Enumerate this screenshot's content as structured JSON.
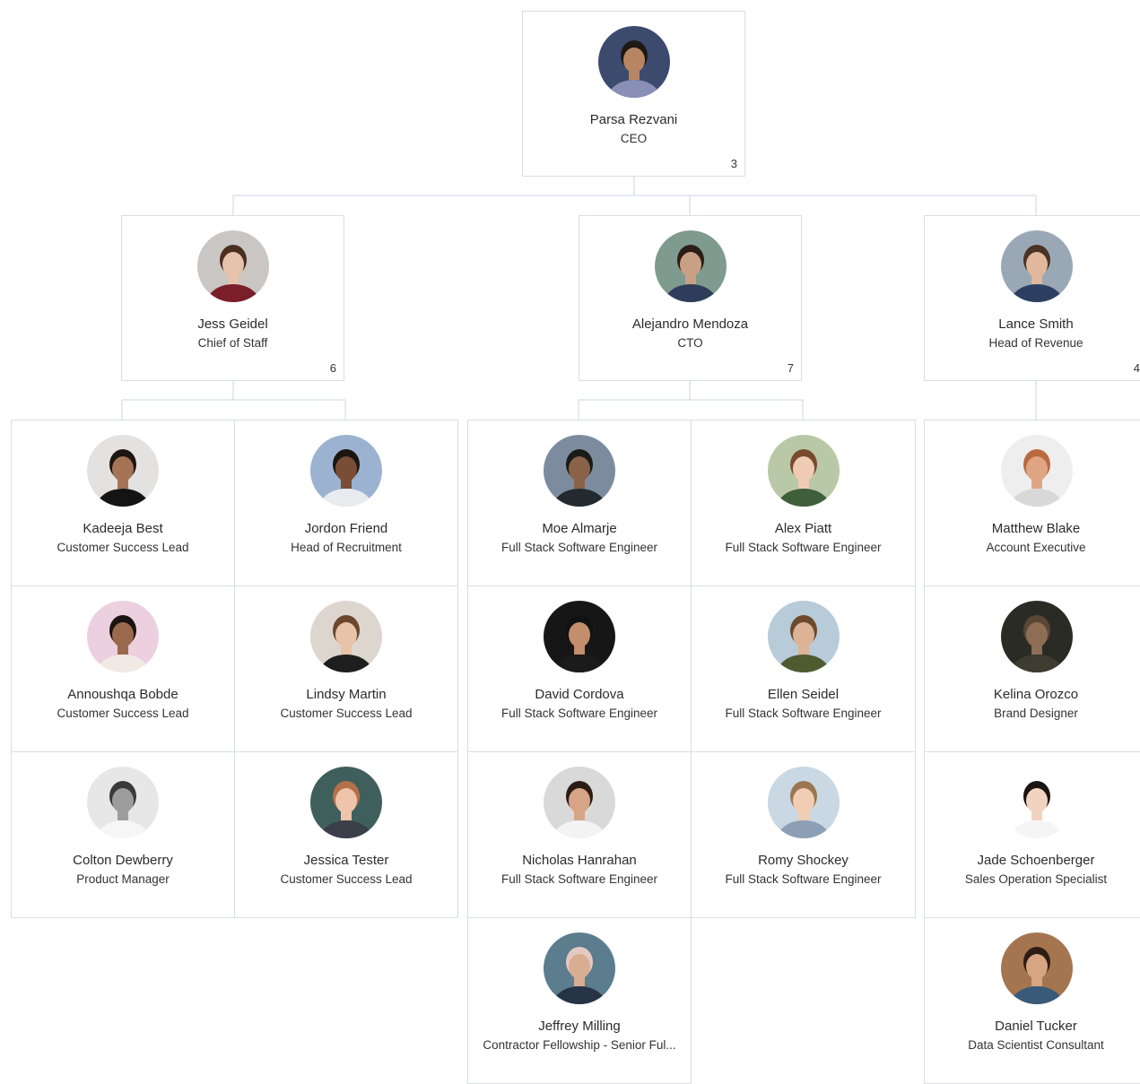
{
  "root": {
    "name": "Parsa Rezvani",
    "title": "CEO",
    "count": "3",
    "avatar": {
      "bg": "#3c4a6e",
      "skin": "#b88563",
      "hair": "#1e1812",
      "shirt": "#8a8fb8"
    }
  },
  "managers": [
    {
      "name": "Jess Geidel",
      "title": "Chief of Staff",
      "count": "6",
      "avatar": {
        "bg": "#c9c6c3",
        "skin": "#e7c2ac",
        "hair": "#4a2e20",
        "shirt": "#7a1f2a"
      }
    },
    {
      "name": "Alejandro Mendoza",
      "title": "CTO",
      "count": "7",
      "avatar": {
        "bg": "#7f9a8e",
        "skin": "#c9a085",
        "hair": "#2a1d16",
        "shirt": "#2f3d5a"
      }
    },
    {
      "name": "Lance Smith",
      "title": "Head of Revenue",
      "count": "4",
      "avatar": {
        "bg": "#9aa8b6",
        "skin": "#e2b89c",
        "hair": "#4a3324",
        "shirt": "#2c3f63"
      }
    }
  ],
  "team_jess": [
    {
      "name": "Kadeeja Best",
      "title": "Customer Success Lead",
      "avatar": {
        "bg": "#e4e2e0",
        "skin": "#a57456",
        "hair": "#1d1511",
        "shirt": "#141414"
      }
    },
    {
      "name": "Jordon Friend",
      "title": "Head of Recruitment",
      "avatar": {
        "bg": "#9bb3d0",
        "skin": "#7a4e36",
        "hair": "#1c1612",
        "shirt": "#e9ecef"
      }
    },
    {
      "name": "Annoushqa Bobde",
      "title": "Customer Success Lead",
      "avatar": {
        "bg": "#ecd0df",
        "skin": "#9b6a4e",
        "hair": "#1b1410",
        "shirt": "#f1e9e4"
      }
    },
    {
      "name": "Lindsy Martin",
      "title": "Customer Success Lead",
      "avatar": {
        "bg": "#ddd6cf",
        "skin": "#e8c3a8",
        "hair": "#6b4730",
        "shirt": "#1e1e1e"
      }
    },
    {
      "name": "Colton Dewberry",
      "title": "Product Manager",
      "avatar": {
        "bg": "#e7e7e7",
        "skin": "#9d9d9d",
        "hair": "#3a3a3a",
        "shirt": "#f6f6f6"
      }
    },
    {
      "name": "Jessica Tester",
      "title": "Customer Success Lead",
      "avatar": {
        "bg": "#3f5f5c",
        "skin": "#eec5ab",
        "hair": "#b5704a",
        "shirt": "#3a3f4a"
      }
    }
  ],
  "team_alejandro": [
    {
      "name": "Moe Almarje",
      "title": "Full Stack Software Engineer",
      "avatar": {
        "bg": "#7c8c9e",
        "skin": "#8a6248",
        "hair": "#1b1a18",
        "shirt": "#222a2f"
      }
    },
    {
      "name": "Alex Piatt",
      "title": "Full Stack Software Engineer",
      "avatar": {
        "bg": "#b9c8a7",
        "skin": "#efcbb4",
        "hair": "#7a4a2e",
        "shirt": "#3f5e3a"
      }
    },
    {
      "name": "David Cordova",
      "title": "Full Stack Software Engineer",
      "avatar": {
        "bg": "#161616",
        "skin": "#c28e6c",
        "hair": "#111111",
        "shirt": "#1b1b1b"
      }
    },
    {
      "name": "Ellen Seidel",
      "title": "Full Stack Software Engineer",
      "avatar": {
        "bg": "#b7cbd9",
        "skin": "#ddb397",
        "hair": "#6b4a2d",
        "shirt": "#4e5b2f"
      }
    },
    {
      "name": "Nicholas Hanrahan",
      "title": "Full Stack Software Engineer",
      "avatar": {
        "bg": "#d9d9d9",
        "skin": "#d7a488",
        "hair": "#2b1d16",
        "shirt": "#f3f3f3"
      }
    },
    {
      "name": "Romy Shockey",
      "title": "Full Stack Software Engineer",
      "avatar": {
        "bg": "#c9d8e3",
        "skin": "#f0cdb3",
        "hair": "#9a7652",
        "shirt": "#8c9fb5"
      }
    },
    {
      "name": "Jeffrey Milling",
      "title": "Contractor Fellowship - Senior Ful...",
      "avatar": {
        "bg": "#5b7d8d",
        "skin": "#d9ad92",
        "hair": "#e4c9c3",
        "shirt": "#263445"
      }
    }
  ],
  "team_lance": [
    {
      "name": "Matthew Blake",
      "title": "Account Executive",
      "avatar": {
        "bg": "#eeeeee",
        "skin": "#e0a585",
        "hair": "#b96a3f",
        "shirt": "#d8d8d8"
      }
    },
    {
      "name": "Kelina Orozco",
      "title": "Brand Designer",
      "avatar": {
        "bg": "#2a2b25",
        "skin": "#8d6e55",
        "hair": "#5b4636",
        "shirt": "#3d3c31"
      }
    },
    {
      "name": "Jade Schoenberger",
      "title": "Sales Operation Specialist",
      "avatar": {
        "bg": "#ffffff",
        "skin": "#f1d3bf",
        "hair": "#1a1412",
        "shirt": "#f5f5f5"
      }
    },
    {
      "name": "Daniel Tucker",
      "title": "Data Scientist Consultant",
      "avatar": {
        "bg": "#a5754f",
        "skin": "#d8a582",
        "hair": "#2c1e15",
        "shirt": "#3a5a7a"
      }
    }
  ]
}
